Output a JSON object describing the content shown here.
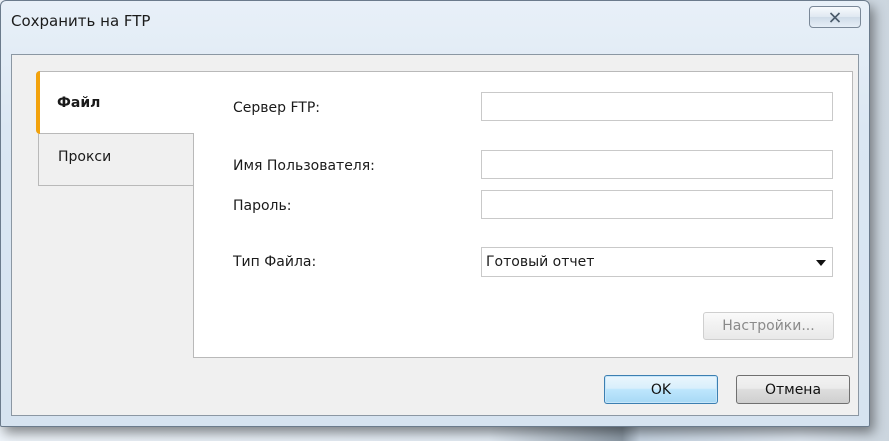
{
  "window": {
    "title": "Сохранить на FTP",
    "close_icon": "close-icon"
  },
  "tabs": [
    {
      "label": "Файл",
      "selected": true
    },
    {
      "label": "Прокси",
      "selected": false
    }
  ],
  "form": {
    "server_label": "Сервер FTP:",
    "server_value": "",
    "username_label": "Имя Пользователя:",
    "username_value": "",
    "password_label": "Пароль:",
    "password_value": "",
    "file_type_label": "Тип Файла:",
    "file_type_value": "Готовый отчет",
    "settings_button": "Настройки..."
  },
  "buttons": {
    "ok": "OK",
    "cancel": "Отмена"
  },
  "colors": {
    "tab_accent": "#f2a20c",
    "default_button_border": "#3c7fb1"
  }
}
